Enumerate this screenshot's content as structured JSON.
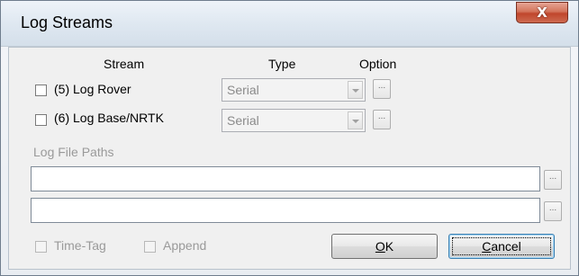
{
  "window": {
    "title": "Log Streams",
    "close_glyph": "X"
  },
  "headers": {
    "stream": "Stream",
    "type": "Type",
    "option": "Option"
  },
  "streams": [
    {
      "label": "(5) Log Rover",
      "checked": false,
      "type": "Serial",
      "option_glyph": "..."
    },
    {
      "label": "(6) Log Base/NRTK",
      "checked": false,
      "type": "Serial",
      "option_glyph": "..."
    }
  ],
  "log_file_paths": {
    "label": "Log File Paths",
    "path1": "",
    "path2": "",
    "browse_glyph": "..."
  },
  "options": {
    "time_tag": "Time-Tag",
    "append": "Append"
  },
  "buttons": {
    "ok_underline": "O",
    "ok_rest": "K",
    "cancel_underline": "C",
    "cancel_rest": "ancel"
  }
}
